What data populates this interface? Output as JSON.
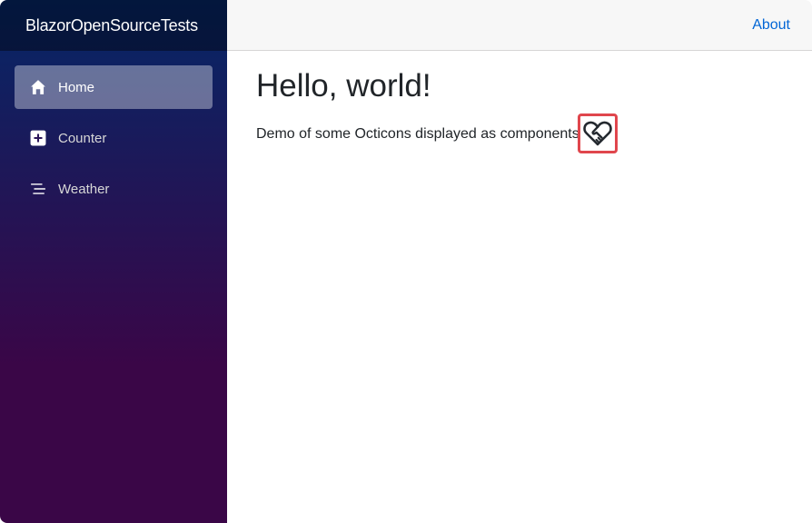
{
  "sidebar": {
    "brand": "BlazorOpenSourceTests",
    "items": [
      {
        "label": "Home",
        "icon": "home-icon",
        "active": true
      },
      {
        "label": "Counter",
        "icon": "plus-square-icon",
        "active": false
      },
      {
        "label": "Weather",
        "icon": "list-lines-icon",
        "active": false
      }
    ]
  },
  "header": {
    "about_label": "About"
  },
  "main": {
    "title": "Hello, world!",
    "description": "Demo of some Octicons displayed as components",
    "icon": "heart-handshake-icon"
  },
  "colors": {
    "sidebar_top": "#052767",
    "sidebar_bottom": "#3a0647",
    "link": "#0366d6",
    "highlight_border": "#e0464d"
  }
}
